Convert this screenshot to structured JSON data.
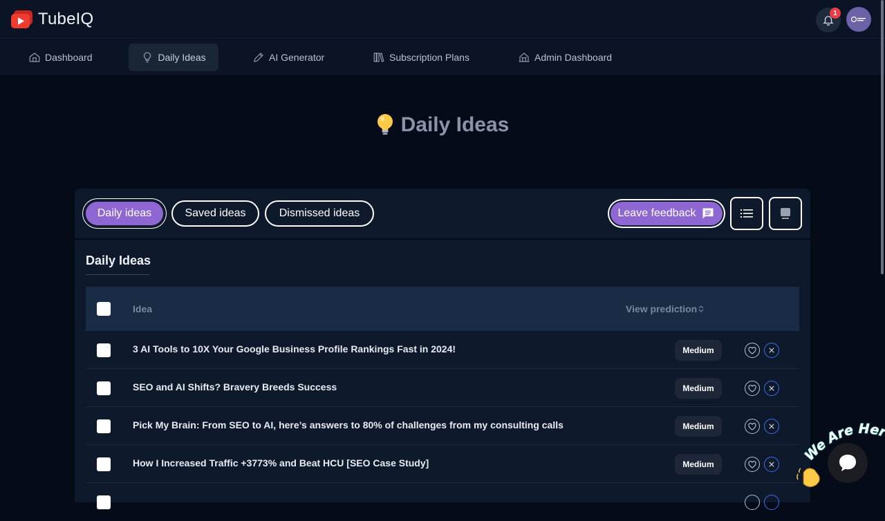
{
  "app": {
    "name": "TubeIQ"
  },
  "header": {
    "notification_count": "1"
  },
  "nav": {
    "items": [
      {
        "label": "Dashboard",
        "icon": "home-icon"
      },
      {
        "label": "Daily Ideas",
        "icon": "lightbulb-icon",
        "active": true
      },
      {
        "label": "AI Generator",
        "icon": "pencil-icon"
      },
      {
        "label": "Subscription Plans",
        "icon": "books-icon"
      },
      {
        "label": "Admin Dashboard",
        "icon": "buildings-icon"
      }
    ]
  },
  "page": {
    "title": "Daily Ideas",
    "title_icon": "lightbulb-emoji-icon"
  },
  "tabs": {
    "daily": "Daily ideas",
    "saved": "Saved ideas",
    "dismissed": "Dismissed ideas",
    "feedback": "Leave feedback"
  },
  "section": {
    "title": "Daily Ideas"
  },
  "table": {
    "columns": {
      "idea": "Idea",
      "prediction": "View prediction"
    },
    "rows": [
      {
        "idea": "3 AI Tools to 10X Your Google Business Profile Rankings Fast in 2024!",
        "prediction": "Medium"
      },
      {
        "idea": "SEO and AI Shifts? Bravery Breeds Success",
        "prediction": "Medium"
      },
      {
        "idea": "Pick My Brain: From SEO to AI, here’s answers to 80% of challenges from my consulting calls",
        "prediction": "Medium"
      },
      {
        "idea": "How I Increased Traffic +3773% and Beat HCU [SEO Case Study]",
        "prediction": "Medium"
      }
    ]
  },
  "chat": {
    "tagline": "We Are Here!"
  },
  "colors": {
    "accent": "#8e67d2",
    "background": "#050b18",
    "card": "#0e1a2c",
    "table_header": "#1a2b45",
    "dismiss_blue": "#3d6ef0",
    "badge_red": "#ef3b45"
  }
}
